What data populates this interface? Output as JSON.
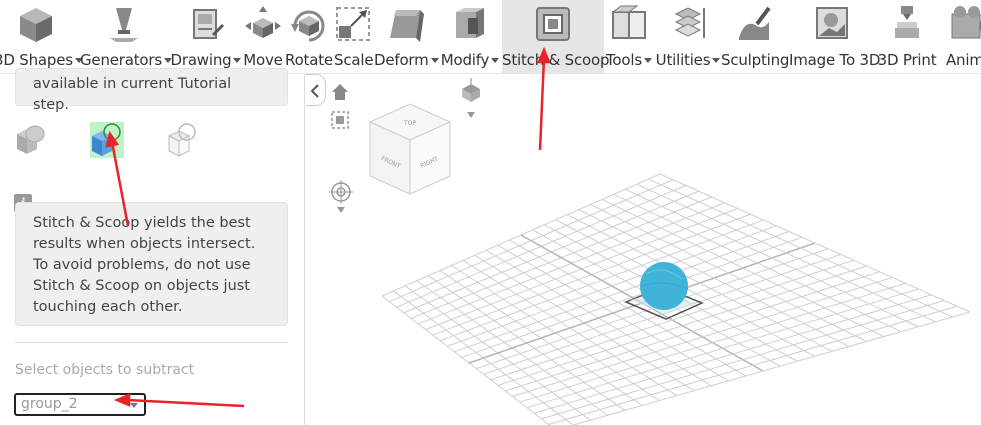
{
  "toolbar": {
    "items": [
      {
        "label": "3D Shapes",
        "caret": true,
        "icon": "cube-icon"
      },
      {
        "label": "Generators",
        "caret": true,
        "icon": "generators-icon"
      },
      {
        "label": "Drawing",
        "caret": true,
        "icon": "drawing-icon"
      },
      {
        "label": "Move",
        "caret": false,
        "icon": "move-icon"
      },
      {
        "label": "Rotate",
        "caret": false,
        "icon": "rotate-icon"
      },
      {
        "label": "Scale",
        "caret": false,
        "icon": "scale-icon"
      },
      {
        "label": "Deform",
        "caret": true,
        "icon": "deform-icon"
      },
      {
        "label": "Modify",
        "caret": true,
        "icon": "modify-icon"
      },
      {
        "label": "Stitch & Scoop",
        "caret": false,
        "icon": "stitch-scoop-icon",
        "active": true
      },
      {
        "label": "Tools",
        "caret": true,
        "icon": "tools-icon"
      },
      {
        "label": "Utilities",
        "caret": true,
        "icon": "utilities-icon"
      },
      {
        "label": "Sculpting",
        "caret": false,
        "icon": "sculpting-icon"
      },
      {
        "label": "Image To 3D",
        "caret": false,
        "icon": "image-to-3d-icon"
      },
      {
        "label": "3D Print",
        "caret": false,
        "icon": "3d-print-icon"
      },
      {
        "label": "Animat",
        "caret": false,
        "icon": "animation-icon"
      }
    ]
  },
  "panel": {
    "note_top": "available in current Tutorial step.",
    "info_badge": "i",
    "info_text": "Stitch & Scoop yields the best results when objects intersect. To avoid problems, do not use Stitch & Scoop on objects just touching each other.",
    "subtract_label": "Select objects to subtract",
    "subtract_value": "group_2"
  },
  "viewcube": {
    "top": "TOP",
    "front": "FRONT",
    "right": "RIGHT"
  },
  "colors": {
    "accent_red": "#e8232a",
    "sphere": "#3fb3d8",
    "active_tab": "#e6e6e6",
    "op_highlight": "#bff2c8"
  }
}
